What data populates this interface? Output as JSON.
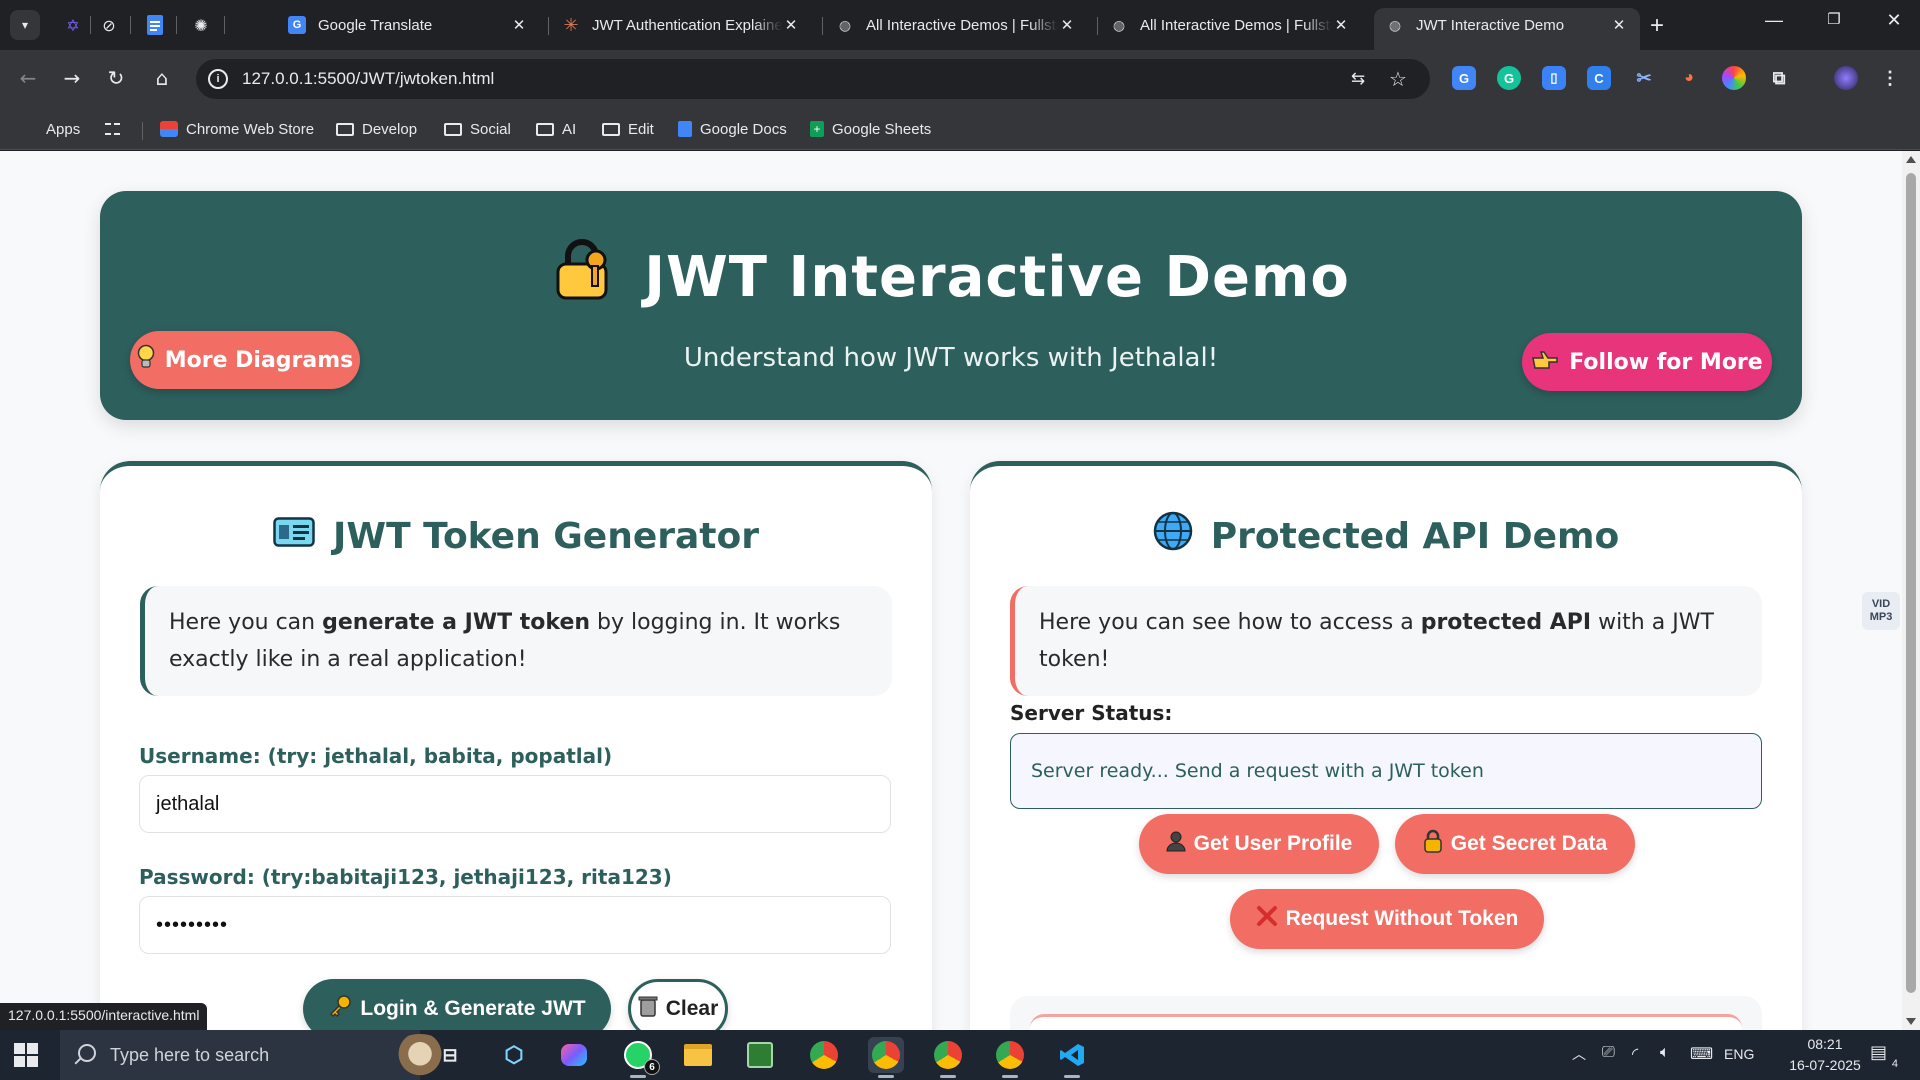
{
  "browser": {
    "pinned_tabs": [
      {
        "icon": "star-of-david-app-icon",
        "color": "#7b61ff"
      },
      {
        "icon": "slash-circle-app-icon",
        "color": "#e8eaed"
      },
      {
        "icon": "google-docs-icon",
        "color": "#4285f4"
      },
      {
        "icon": "openai-icon",
        "color": "#e8eaed"
      }
    ],
    "tabs": [
      {
        "title": "Google Translate",
        "icon": "google-translate-icon"
      },
      {
        "title": "JWT Authentication Explained",
        "icon": "claude-icon"
      },
      {
        "title": "All Interactive Demos | Fullstack",
        "icon": "globe-icon"
      },
      {
        "title": "All Interactive Demos | Fullstack",
        "icon": "globe-icon"
      },
      {
        "title": "JWT Interactive Demo",
        "icon": "globe-icon",
        "active": true
      }
    ],
    "new_tab_label": "+",
    "url": "127.0.0.1:5500/JWT/jwtoken.html",
    "bookmarks": [
      {
        "label": "Apps",
        "icon": "apps-grid-icon"
      },
      {
        "label": "",
        "icon": "tab-groups-icon"
      },
      {
        "label": "Chrome Web Store",
        "icon": "chrome-web-store-icon"
      },
      {
        "label": "Develop",
        "icon": "folder-icon"
      },
      {
        "label": "Social",
        "icon": "folder-icon"
      },
      {
        "label": "AI",
        "icon": "folder-icon"
      },
      {
        "label": "Edit",
        "icon": "folder-icon"
      },
      {
        "label": "Google Docs",
        "icon": "google-docs-icon"
      },
      {
        "label": "Google Sheets",
        "icon": "google-sheets-icon"
      }
    ],
    "status_url": "127.0.0.1:5500/interactive.html"
  },
  "hero": {
    "title": "JWT Interactive Demo",
    "subtitle": "Understand how JWT works with Jethalal!",
    "more_button": "More Diagrams",
    "follow_button": "Follow for More"
  },
  "generator": {
    "title": "JWT Token Generator",
    "info_pre": "Here you can ",
    "info_bold": "generate a JWT token",
    "info_post": " by logging in. It works exactly like in a real application!",
    "username_label": "Username: (try: jethalal, babita, popatlal)",
    "username_value": "jethalal",
    "password_label": "Password: (try:babitaji123, jethaji123, rita123)",
    "password_value": "•••••••••",
    "login_button": "Login & Generate JWT",
    "clear_button": "Clear"
  },
  "api": {
    "title": "Protected API Demo",
    "info_pre": "Here you can see how to access a ",
    "info_bold": "protected API",
    "info_post": " with a JWT token!",
    "status_label": "Server Status:",
    "status_text": "Server ready... Send a request with a JWT token",
    "profile_button": "Get User Profile",
    "secret_button": "Get Secret Data",
    "notoken_button": "Request Without Token"
  },
  "side_widget": {
    "line1": "VID",
    "line2": "MP3"
  },
  "taskbar": {
    "search_placeholder": "Type here to search",
    "whatsapp_badge": "6",
    "language": "ENG",
    "time": "08:21",
    "date": "16-07-2025",
    "notifications": "4"
  },
  "colors": {
    "primary": "#2d5f5d",
    "coral": "#f26d63",
    "pink": "#e8347a"
  }
}
